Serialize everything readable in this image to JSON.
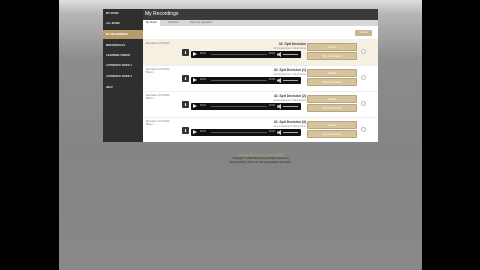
{
  "sidebar": {
    "items": [
      {
        "label": "MY MUSIC"
      },
      {
        "label": "ALL MUSIC"
      },
      {
        "label": "MY RECORDINGS"
      },
      {
        "label": "MINI MANUALS"
      },
      {
        "label": "LEARNING VIDEOS"
      },
      {
        "label": "AUTOMATIC BOOK 1"
      },
      {
        "label": "AUTOMATIC BOOK 2"
      },
      {
        "label": "HELP"
      }
    ],
    "active_index": 2
  },
  "header": {
    "title": "My Recordings"
  },
  "tabs": [
    {
      "label": "My Music"
    },
    {
      "label": "All Music"
    },
    {
      "label": "Recently Uploaded"
    }
  ],
  "toolbar": {
    "top_button": "Refresh"
  },
  "recordings": [
    {
      "date": "Recorded: 10/7/2020",
      "book": "Book 1",
      "title": "32. Spit Decision",
      "subtitle": "Accompaniment / Metronome",
      "time_start": "00:00",
      "time_end": "00:00",
      "button1": "Submit",
      "button2": "My Comments"
    },
    {
      "date": "Recorded: 10/7/2020",
      "book": "Book 1",
      "title": "32. Spit Decision (1)",
      "subtitle": "Accompaniment / Metronome",
      "time_start": "00:00",
      "time_end": "00:00",
      "button1": "Submit",
      "button2": "My Comments"
    },
    {
      "date": "Recorded: 10/7/2020",
      "book": "Book 1",
      "title": "32. Spit Decision (2)",
      "subtitle": "Accompaniment / Metronome",
      "time_start": "00:00",
      "time_end": "00:00",
      "button1": "Submit",
      "button2": "My Comments"
    },
    {
      "date": "Recorded: 10/7/2020",
      "book": "Book 1",
      "title": "32. Spit Decision (3)",
      "subtitle": "Accompaniment / Metronome",
      "time_start": "00:00",
      "time_end": "00:00",
      "button1": "Submit",
      "button2": "My Comments"
    }
  ],
  "footer": {
    "line1": "Contact Us  |  Privacy  |  Terms of Use",
    "line2": "Copyright © 2020  MusicFirst  All Rights Reserved",
    "line3": "Privacy Policy | Terms of Use | Acceptable Use Policy"
  },
  "colors": {
    "accent": "#b79a6a",
    "sidebar_bg": "#2f2f2f",
    "button_bg": "#d6c29b"
  }
}
